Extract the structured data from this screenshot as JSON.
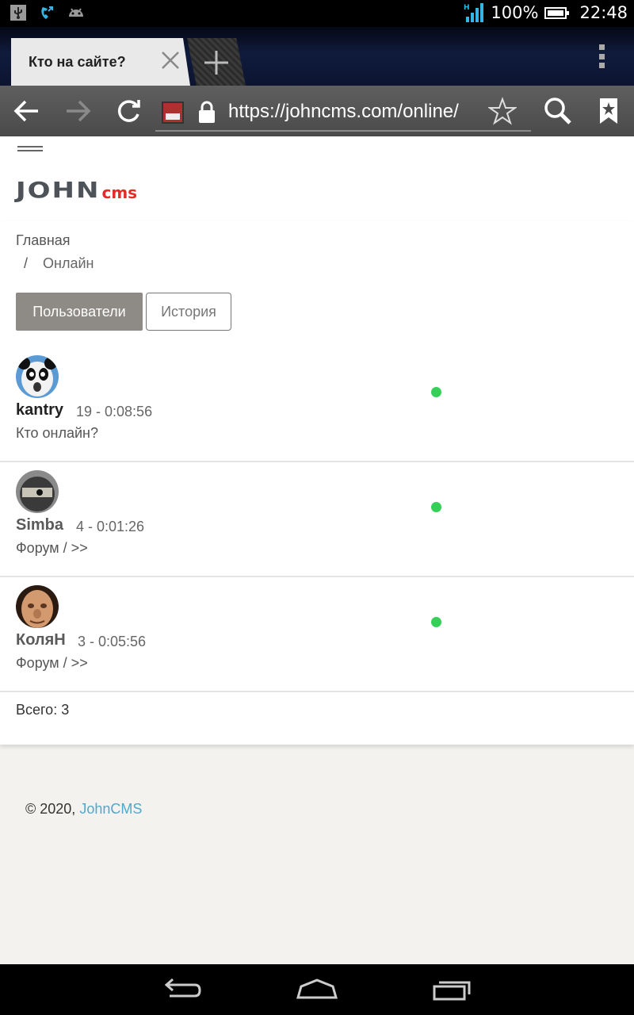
{
  "status_bar": {
    "network": "H",
    "battery": "100%",
    "time": "22:48"
  },
  "browser": {
    "tab_title": "Кто на сайте?",
    "url": "https://johncms.com/online/"
  },
  "site": {
    "logo_main": "JOHN",
    "logo_sub": "cms"
  },
  "breadcrumb": {
    "home": "Главная",
    "separator": "/",
    "current": "Онлайн"
  },
  "tabs": {
    "users": "Пользователи",
    "history": "История"
  },
  "users": [
    {
      "name": "kantry",
      "time": "19 - 0:08:56",
      "place": "Кто онлайн?",
      "name_color": "#222222",
      "status": "online"
    },
    {
      "name": "Simba",
      "time": "4 - 0:01:26",
      "place": "Форум / >>",
      "name_color": "#5a5a5a",
      "status": "online"
    },
    {
      "name": "КоляН",
      "time": "3 - 0:05:56",
      "place": "Форум / >>",
      "name_color": "#5a5a5a",
      "status": "online"
    }
  ],
  "total": "Всего: 3",
  "footer": {
    "copyright": "© 2020,",
    "link": "JohnCMS"
  },
  "colors": {
    "active_tab": "#8e8b86",
    "online": "#34d058",
    "logo_red": "#e32b2b",
    "link": "#52a8c8"
  }
}
